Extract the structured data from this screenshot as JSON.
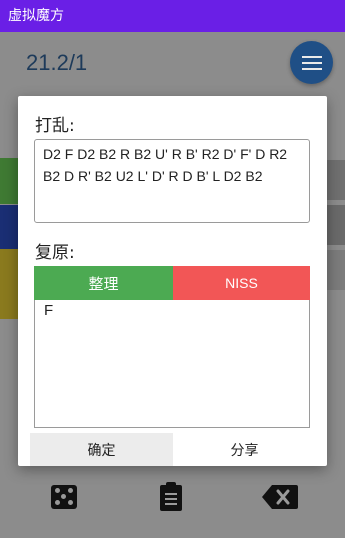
{
  "statusbar": {
    "title": "虚拟魔方"
  },
  "app": {
    "ratio": "21.2/1",
    "menu_icon": "menu-icon"
  },
  "dialog": {
    "scramble_label": "打乱:",
    "scramble_text": "D2 F D2 B2 R B2 U' R B' R2 D' F' D R2 B2 D R' B2 U2 L' D' R D B' L D2 B2",
    "solve_label": "复原:",
    "organize_label": "整理",
    "niss_label": "NISS",
    "solve_text": "F",
    "ok_label": "确定",
    "share_label": "分享"
  },
  "colors": {
    "status": "#6a1fe6",
    "organize": "#4caa52",
    "niss": "#f25656",
    "menu": "#1f4f86"
  },
  "bottom_icons": [
    "dice-icon",
    "clipboard-icon",
    "backspace-icon"
  ]
}
